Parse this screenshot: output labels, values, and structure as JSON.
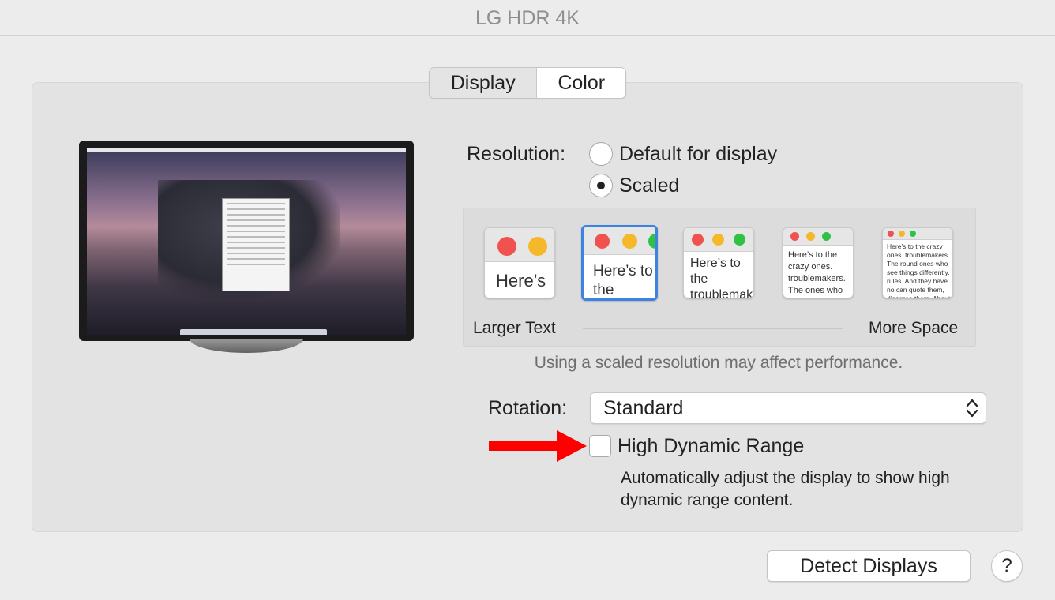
{
  "window": {
    "title": "LG HDR 4K"
  },
  "tabs": [
    {
      "label": "Display",
      "selected": true
    },
    {
      "label": "Color",
      "selected": false
    }
  ],
  "resolution": {
    "label": "Resolution:",
    "options": [
      {
        "label": "Default for display",
        "selected": false
      },
      {
        "label": "Scaled",
        "selected": true
      }
    ],
    "scaled_previews": [
      {
        "text": "Here’s",
        "selected": false
      },
      {
        "text": "Here’s to the troublemakers",
        "selected": true
      },
      {
        "text": "Here’s to the troublemakers. ones who",
        "selected": false
      },
      {
        "text": "Here’s to the crazy ones. troublemakers. The ones who see things rules. And they",
        "selected": false
      },
      {
        "text": "Here’s to the crazy ones. troublemakers. The round ones who see things differently. rules. And they have no can quote them, disagree them. About the only thing Because they change the",
        "selected": false
      }
    ],
    "slider_left": "Larger Text",
    "slider_right": "More Space",
    "note": "Using a scaled resolution may affect performance."
  },
  "rotation": {
    "label": "Rotation:",
    "value": "Standard"
  },
  "hdr": {
    "label": "High Dynamic Range",
    "checked": false,
    "description": "Automatically adjust the display to show high dynamic range content."
  },
  "buttons": {
    "detect": "Detect Displays",
    "help": "?"
  },
  "colors": {
    "arrow": "#ff0000",
    "selection": "#3d84e0",
    "close": "#f0524f",
    "minimize": "#f5b829",
    "zoom": "#30c244"
  }
}
